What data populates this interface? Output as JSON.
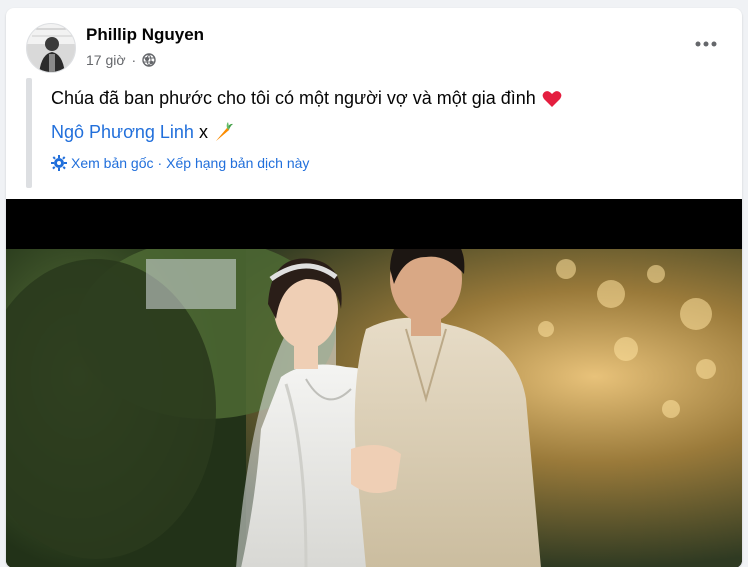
{
  "post": {
    "author": "Phillip Nguyen",
    "time": "17 giờ",
    "privacy_icon": "globe-icon",
    "more_icon": "more-options-icon",
    "text": "Chúa đã ban phước cho tôi có một người vợ và một gia đình",
    "text_emoji": "red-heart",
    "tagged_name": "Ngô Phương Linh",
    "tag_suffix": "x",
    "tag_emoji": "carrot",
    "translate": {
      "view_original": "Xem bản gốc",
      "separator": "·",
      "rate_translation": "Xếp hạng bản dịch này"
    },
    "photo_icon": "wedding-photo"
  },
  "colors": {
    "link": "#216fdb",
    "heart": "#e41e3f",
    "secondary_text": "#65676b"
  }
}
